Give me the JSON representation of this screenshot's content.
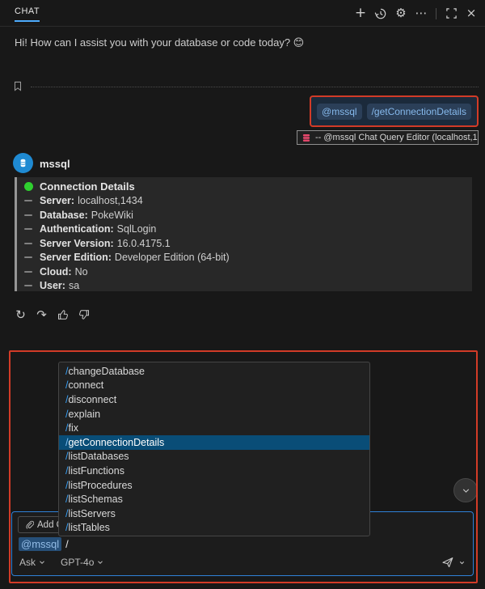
{
  "titlebar": {
    "tab": "CHAT"
  },
  "greeting": {
    "text": "Hi! How can I assist you with your database or code today? 😊"
  },
  "user_request": {
    "chips": [
      {
        "text": "@mssql"
      },
      {
        "text": "/getConnectionDetails"
      }
    ]
  },
  "editor_ref": {
    "text": "-- @mssql Chat Query Editor (localhost,1"
  },
  "assistant": {
    "name": "mssql"
  },
  "connection": {
    "title": "Connection Details",
    "fields": [
      {
        "label": "Server:",
        "value": "localhost,1434"
      },
      {
        "label": "Database:",
        "value": "PokeWiki"
      },
      {
        "label": "Authentication:",
        "value": "SqlLogin"
      },
      {
        "label": "Server Version:",
        "value": "16.0.4175.1"
      },
      {
        "label": "Server Edition:",
        "value": "Developer Edition (64-bit)"
      },
      {
        "label": "Cloud:",
        "value": "No"
      },
      {
        "label": "User:",
        "value": "sa"
      }
    ]
  },
  "slash_menu": {
    "selected_index": 5,
    "items": [
      {
        "slash": "/",
        "name": "changeDatabase"
      },
      {
        "slash": "/",
        "name": "connect"
      },
      {
        "slash": "/",
        "name": "disconnect"
      },
      {
        "slash": "/",
        "name": "explain"
      },
      {
        "slash": "/",
        "name": "fix"
      },
      {
        "slash": "/",
        "name": "getConnectionDetails"
      },
      {
        "slash": "/",
        "name": "listDatabases"
      },
      {
        "slash": "/",
        "name": "listFunctions"
      },
      {
        "slash": "/",
        "name": "listProcedures"
      },
      {
        "slash": "/",
        "name": "listSchemas"
      },
      {
        "slash": "/",
        "name": "listServers"
      },
      {
        "slash": "/",
        "name": "listTables"
      }
    ]
  },
  "input": {
    "add_context_label": "Add C",
    "agent_chip": "@mssql",
    "typed": "/",
    "mode": "Ask",
    "model": "GPT-4o"
  },
  "colors": {
    "annotation_red": "#d23b27",
    "focus_blue": "#2f81d8",
    "selection_blue": "#094d77",
    "status_green": "#2fd02f",
    "tab_underline": "#4daafc",
    "db_icon_pink": "#e8486d",
    "avatar_blue": "#1f8ad2"
  }
}
